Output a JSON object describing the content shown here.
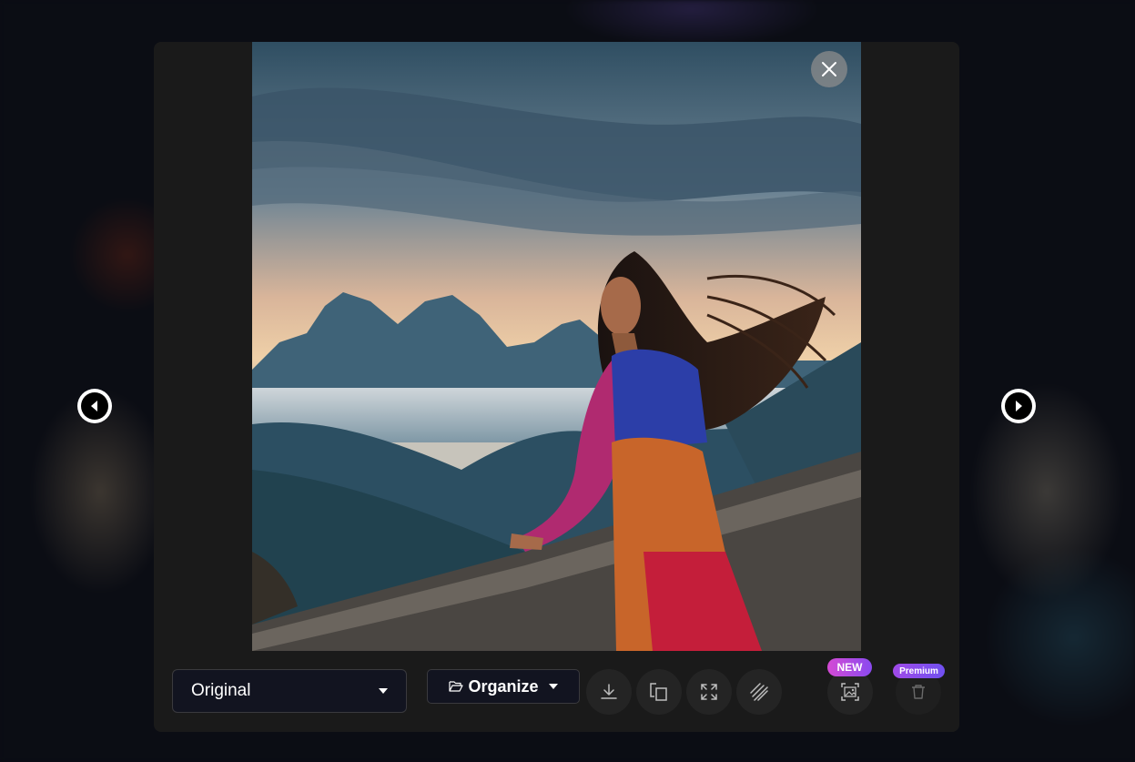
{
  "viewer": {
    "close_icon": "close-icon",
    "prev_icon": "arrow-left-icon",
    "next_icon": "arrow-right-icon"
  },
  "toolbar": {
    "version_select": {
      "value": "Original",
      "icon": "caret-down-icon"
    },
    "organize": {
      "label": "Organize",
      "icon": "folder-open-icon",
      "caret": "caret-down-icon"
    },
    "actions": [
      {
        "name": "download",
        "icon": "download-icon"
      },
      {
        "name": "copy",
        "icon": "copy-icon"
      },
      {
        "name": "fullscreen",
        "icon": "expand-icon"
      },
      {
        "name": "remix",
        "icon": "hatch-icon"
      },
      {
        "name": "image-tool",
        "icon": "scan-image-icon",
        "badge": "NEW"
      },
      {
        "name": "delete",
        "icon": "trash-icon",
        "badge": "Premium"
      }
    ]
  },
  "colors": {
    "modal_bg": "#1a1a1a",
    "badge_new": "#c04ae0",
    "badge_premium": "#8a4af0"
  }
}
